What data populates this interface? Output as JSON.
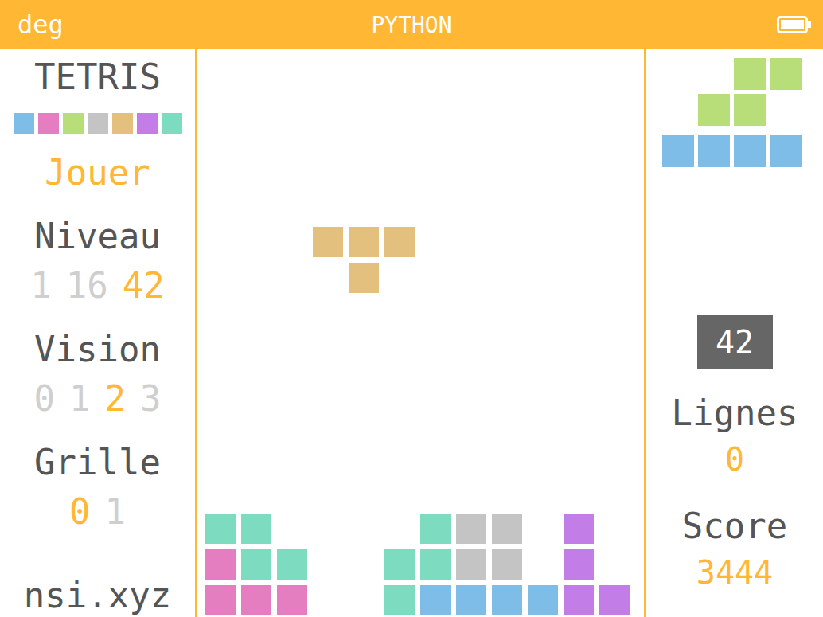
{
  "status_bar": {
    "angle_unit": "deg",
    "app": "PYTHON",
    "battery_level": 1
  },
  "menu": {
    "title": "TETRIS",
    "palette": [
      {
        "color": "#7dbde8"
      },
      {
        "color": "#e57ec0"
      },
      {
        "color": "#b8de7a"
      },
      {
        "color": "#c4c4c4"
      },
      {
        "color": "#e3c07e"
      },
      {
        "color": "#c27ee6"
      },
      {
        "color": "#7ddcc0"
      }
    ],
    "play": "Jouer",
    "settings": [
      {
        "label": "Niveau",
        "options": [
          {
            "label": "1",
            "selected": false
          },
          {
            "label": "16",
            "selected": false
          },
          {
            "label": "42",
            "selected": true
          }
        ]
      },
      {
        "label": "Vision",
        "options": [
          {
            "label": "0",
            "selected": false
          },
          {
            "label": "1",
            "selected": false
          },
          {
            "label": "2",
            "selected": true
          },
          {
            "label": "3",
            "selected": false
          }
        ]
      },
      {
        "label": "Grille",
        "options": [
          {
            "label": "0",
            "selected": true
          },
          {
            "label": "1",
            "selected": false
          }
        ]
      }
    ],
    "footer": "nsi.xyz"
  },
  "board": {
    "columns": 12,
    "rows": 15,
    "cells": [
      {
        "col": 0,
        "row": 0,
        "color": "#e57ec0"
      },
      {
        "col": 1,
        "row": 0,
        "color": "#e57ec0"
      },
      {
        "col": 2,
        "row": 0,
        "color": "#e57ec0"
      },
      {
        "col": 5,
        "row": 0,
        "color": "#7ddcc0"
      },
      {
        "col": 6,
        "row": 0,
        "color": "#7dbde8"
      },
      {
        "col": 7,
        "row": 0,
        "color": "#7dbde8"
      },
      {
        "col": 8,
        "row": 0,
        "color": "#7dbde8"
      },
      {
        "col": 9,
        "row": 0,
        "color": "#7dbde8"
      },
      {
        "col": 10,
        "row": 0,
        "color": "#c27ee6"
      },
      {
        "col": 11,
        "row": 0,
        "color": "#c27ee6"
      },
      {
        "col": 0,
        "row": 1,
        "color": "#e57ec0"
      },
      {
        "col": 1,
        "row": 1,
        "color": "#7ddcc0"
      },
      {
        "col": 2,
        "row": 1,
        "color": "#7ddcc0"
      },
      {
        "col": 5,
        "row": 1,
        "color": "#7ddcc0"
      },
      {
        "col": 6,
        "row": 1,
        "color": "#7ddcc0"
      },
      {
        "col": 7,
        "row": 1,
        "color": "#c4c4c4"
      },
      {
        "col": 8,
        "row": 1,
        "color": "#c4c4c4"
      },
      {
        "col": 10,
        "row": 1,
        "color": "#c27ee6"
      },
      {
        "col": 0,
        "row": 2,
        "color": "#7ddcc0"
      },
      {
        "col": 1,
        "row": 2,
        "color": "#7ddcc0"
      },
      {
        "col": 6,
        "row": 2,
        "color": "#7ddcc0"
      },
      {
        "col": 7,
        "row": 2,
        "color": "#c4c4c4"
      },
      {
        "col": 8,
        "row": 2,
        "color": "#c4c4c4"
      },
      {
        "col": 10,
        "row": 2,
        "color": "#c27ee6"
      },
      {
        "col": 3,
        "row": 10,
        "color": "#e3c07e"
      },
      {
        "col": 4,
        "row": 10,
        "color": "#e3c07e"
      },
      {
        "col": 5,
        "row": 10,
        "color": "#e3c07e"
      },
      {
        "col": 4,
        "row": 9,
        "color": "#e3c07e"
      }
    ]
  },
  "next_pieces": [
    {
      "color": "#b8de7a",
      "cells": [
        [
          0,
          2
        ],
        [
          0,
          3
        ],
        [
          1,
          1
        ],
        [
          1,
          2
        ]
      ]
    },
    {
      "color": "#7dbde8",
      "cells": [
        [
          0,
          0
        ],
        [
          0,
          1
        ],
        [
          0,
          2
        ],
        [
          0,
          3
        ]
      ]
    }
  ],
  "level_badge": "42",
  "lines": {
    "label": "Lignes",
    "value": "0"
  },
  "score": {
    "label": "Score",
    "value": "3444"
  }
}
